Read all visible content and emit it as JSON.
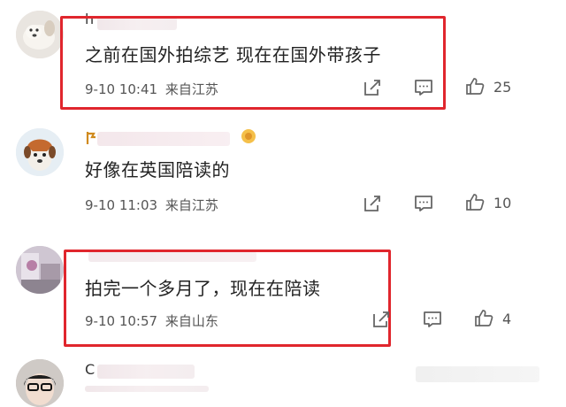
{
  "comments": [
    {
      "text": "之前在国外拍综艺 现在在国外带孩子",
      "date": "9-10",
      "time": "10:41",
      "location": "来自江苏",
      "likes": "25",
      "name_initial": "h"
    },
    {
      "text": "好像在英国陪读的",
      "date": "9-10",
      "time": "11:03",
      "location": "来自江苏",
      "likes": "10",
      "name_initial": ""
    },
    {
      "text": "拍完一个多月了，现在在陪读",
      "date": "9-10",
      "time": "10:57",
      "location": "来自山东",
      "likes": "4",
      "name_initial": ""
    },
    {
      "text": "",
      "date": "",
      "time": "",
      "location": "",
      "likes": "",
      "name_initial": "C"
    }
  ],
  "colors": {
    "highlight": "#e0262d",
    "icon": "#666666",
    "text": "#222222"
  },
  "icons": [
    "share-icon",
    "comment-icon",
    "like-icon"
  ]
}
